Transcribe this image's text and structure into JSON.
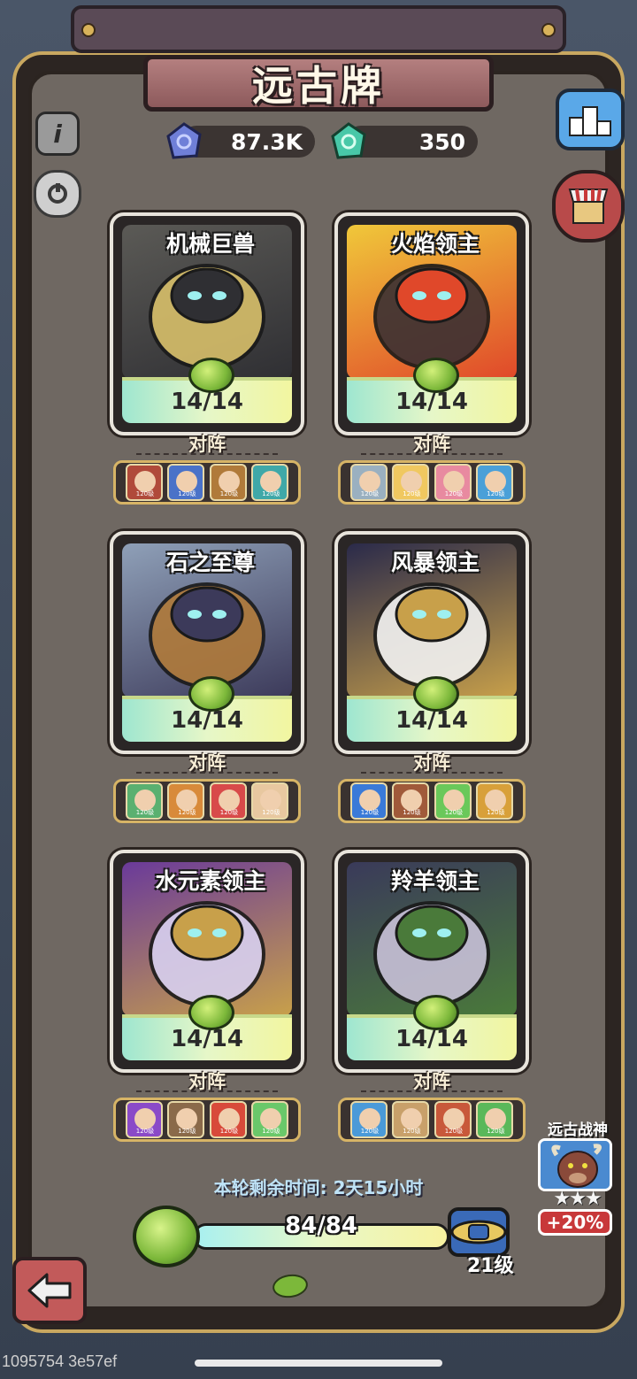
{
  "header": {
    "title": "远古牌"
  },
  "resources": [
    {
      "value": "87.3K",
      "icon": "blue-crystal-icon",
      "color": "#6f7fd8"
    },
    {
      "value": "350",
      "icon": "green-crystal-icon",
      "color": "#48c8a8"
    }
  ],
  "cards": [
    {
      "name": "机械巨兽",
      "count": "14/14",
      "vs": "对阵",
      "palette": [
        "#5b5a56",
        "#d8bf6a",
        "#2f2f33"
      ],
      "team_colors": [
        "#b04a3a",
        "#4a72c8",
        "#b07a3a",
        "#3fa8a8"
      ]
    },
    {
      "name": "火焰领主",
      "count": "14/14",
      "vs": "对阵",
      "palette": [
        "#f0c83a",
        "#3a3034",
        "#e0482a"
      ],
      "team_colors": [
        "#9ab0c0",
        "#f0c860",
        "#e88aa0",
        "#4aa0d8"
      ]
    },
    {
      "name": "石之至尊",
      "count": "14/14",
      "vs": "对阵",
      "palette": [
        "#8fa0b8",
        "#b07a3a",
        "#3c3a5a"
      ],
      "team_colors": [
        "#5ab070",
        "#d88a3a",
        "#d84a4a",
        "#e8c8a0"
      ]
    },
    {
      "name": "风暴领主",
      "count": "14/14",
      "vs": "对阵",
      "palette": [
        "#2a2a4a",
        "#f2f2f2",
        "#c8a04a"
      ],
      "team_colors": [
        "#3a7ad8",
        "#a05a3a",
        "#6ac85a",
        "#d8a03a"
      ]
    },
    {
      "name": "水元素领主",
      "count": "14/14",
      "vs": "对阵",
      "palette": [
        "#6a3a9a",
        "#d8d0f0",
        "#c8a04a"
      ],
      "team_colors": [
        "#8a4ac8",
        "#8a6a4a",
        "#d84a3a",
        "#6ac86a"
      ]
    },
    {
      "name": "羚羊领主",
      "count": "14/14",
      "vs": "对阵",
      "palette": [
        "#3a3a5a",
        "#c8c0d8",
        "#4a7a3a"
      ],
      "team_colors": [
        "#4a9ad8",
        "#c8a06a",
        "#c8583a",
        "#5ab85a"
      ]
    }
  ],
  "hero_level": "120级",
  "footer": {
    "timer": "本轮剩余时间: 2天15小时",
    "progress_text": "84/84",
    "progress_fraction": 1.0,
    "level": "21级",
    "ancient_god": {
      "title": "远古战神",
      "stars": "★★★",
      "bonus": "+20%"
    }
  },
  "watermark": "1095754 3e57ef"
}
